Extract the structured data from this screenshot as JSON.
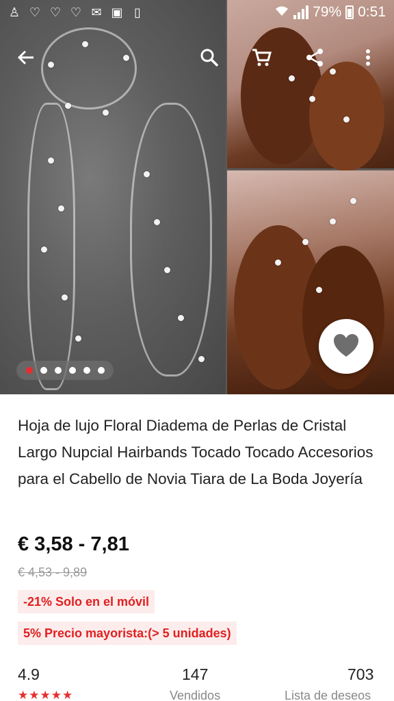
{
  "status_bar": {
    "notification_icons": [
      "accessibility-icon",
      "heart-icon",
      "heart-icon",
      "heart-icon",
      "mail-icon",
      "gallery-icon",
      "clipboard-icon"
    ],
    "battery": "79%",
    "time": "0:51"
  },
  "toolbar": {
    "icons": [
      "back-arrow-icon",
      "search-icon",
      "cart-icon",
      "share-icon",
      "more-vert-icon"
    ]
  },
  "carousel": {
    "count": 6,
    "active_index": 0
  },
  "product": {
    "title": "Hoja de lujo Floral Diadema de Perlas de Cristal Largo Nupcial Hairbands Tocado Tocado Accesorios para el Cabello de Novia Tiara de La Boda Joyería",
    "price": "€ 3,58 - 7,81",
    "old_price": "€ 4,53 - 9,89",
    "mobile_discount": "-21% Solo en el móvil",
    "wholesale": "5% Precio mayorista:(> 5 unidades)"
  },
  "stats": {
    "rating": "4.9",
    "rating_stars": "★★★★★",
    "sold_count": "147",
    "sold_label": "Vendidos",
    "wishlist_count": "703",
    "wishlist_label": "Lista de deseos"
  },
  "colors": {
    "accent": "#e62e2e",
    "tag_bg": "#fdecec"
  }
}
